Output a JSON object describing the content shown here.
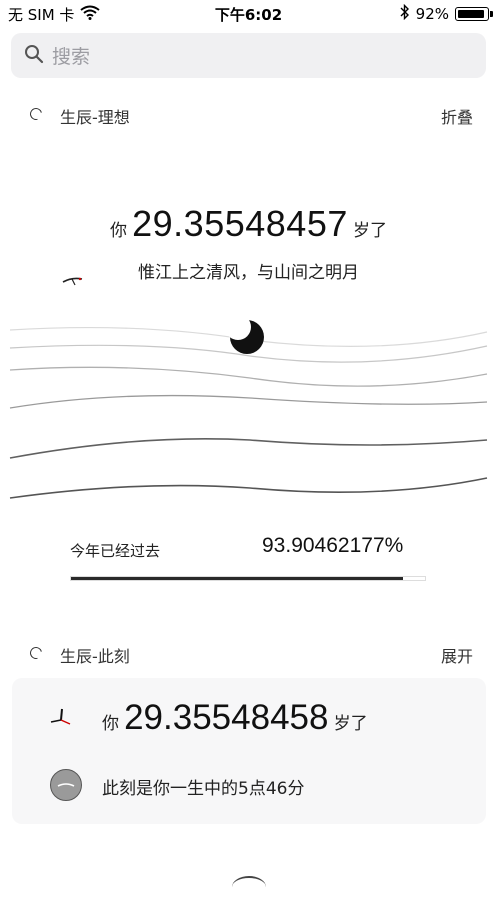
{
  "status_bar": {
    "carrier": "无 SIM 卡",
    "time": "下午6:02",
    "battery": "92%",
    "battery_level": 0.92
  },
  "search": {
    "placeholder": "搜索"
  },
  "section1": {
    "title": "生辰-理想",
    "action": "折叠",
    "age_prefix": "你",
    "age_value": "29.35548457",
    "age_suffix": "岁了",
    "poem": "惟江上之清风，与山间之明月",
    "year_label": "今年已经过去",
    "year_percent": "93.90462177%",
    "year_progress": 0.939
  },
  "section2": {
    "title": "生辰-此刻",
    "action": "展开",
    "age_prefix": "你",
    "age_value": "29.35548458",
    "age_suffix": "岁了",
    "moment_text": "此刻是你一生中的5点46分"
  },
  "icons": {
    "search": "search-icon",
    "wifi": "wifi-icon",
    "bluetooth": "bluetooth-icon",
    "moon": "moon-icon",
    "clock": "clock-icon"
  }
}
